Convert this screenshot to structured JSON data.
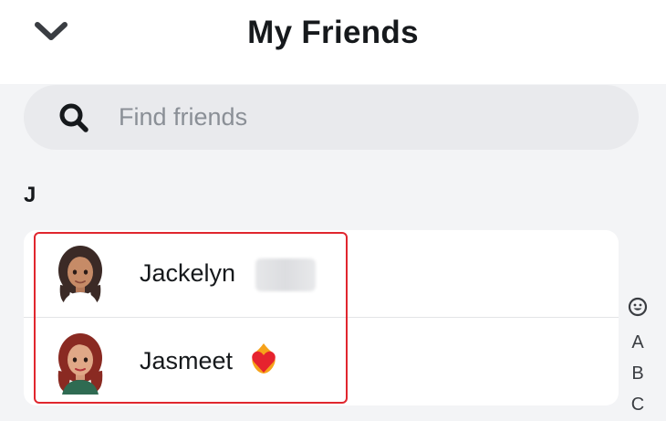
{
  "header": {
    "back_icon": "chevron-down-icon",
    "title": "My Friends"
  },
  "search": {
    "icon": "search-icon",
    "placeholder": "Find friends",
    "value": ""
  },
  "sections": [
    {
      "letter": "J",
      "friends": [
        {
          "name": "Jackelyn",
          "surname_hidden": true,
          "avatar": "bitmoji-avatar-dark-hair"
        },
        {
          "name": "Jasmeet",
          "emoji": "heart-on-fire-emoji",
          "avatar": "bitmoji-avatar-red-hair"
        }
      ]
    }
  ],
  "index_bar": {
    "emoji_icon": "smiley-icon",
    "letters": [
      "A",
      "B",
      "C"
    ]
  },
  "colors": {
    "background": "#f3f4f6",
    "highlight_border": "#e0262e",
    "search_bg": "#e9eaed"
  }
}
